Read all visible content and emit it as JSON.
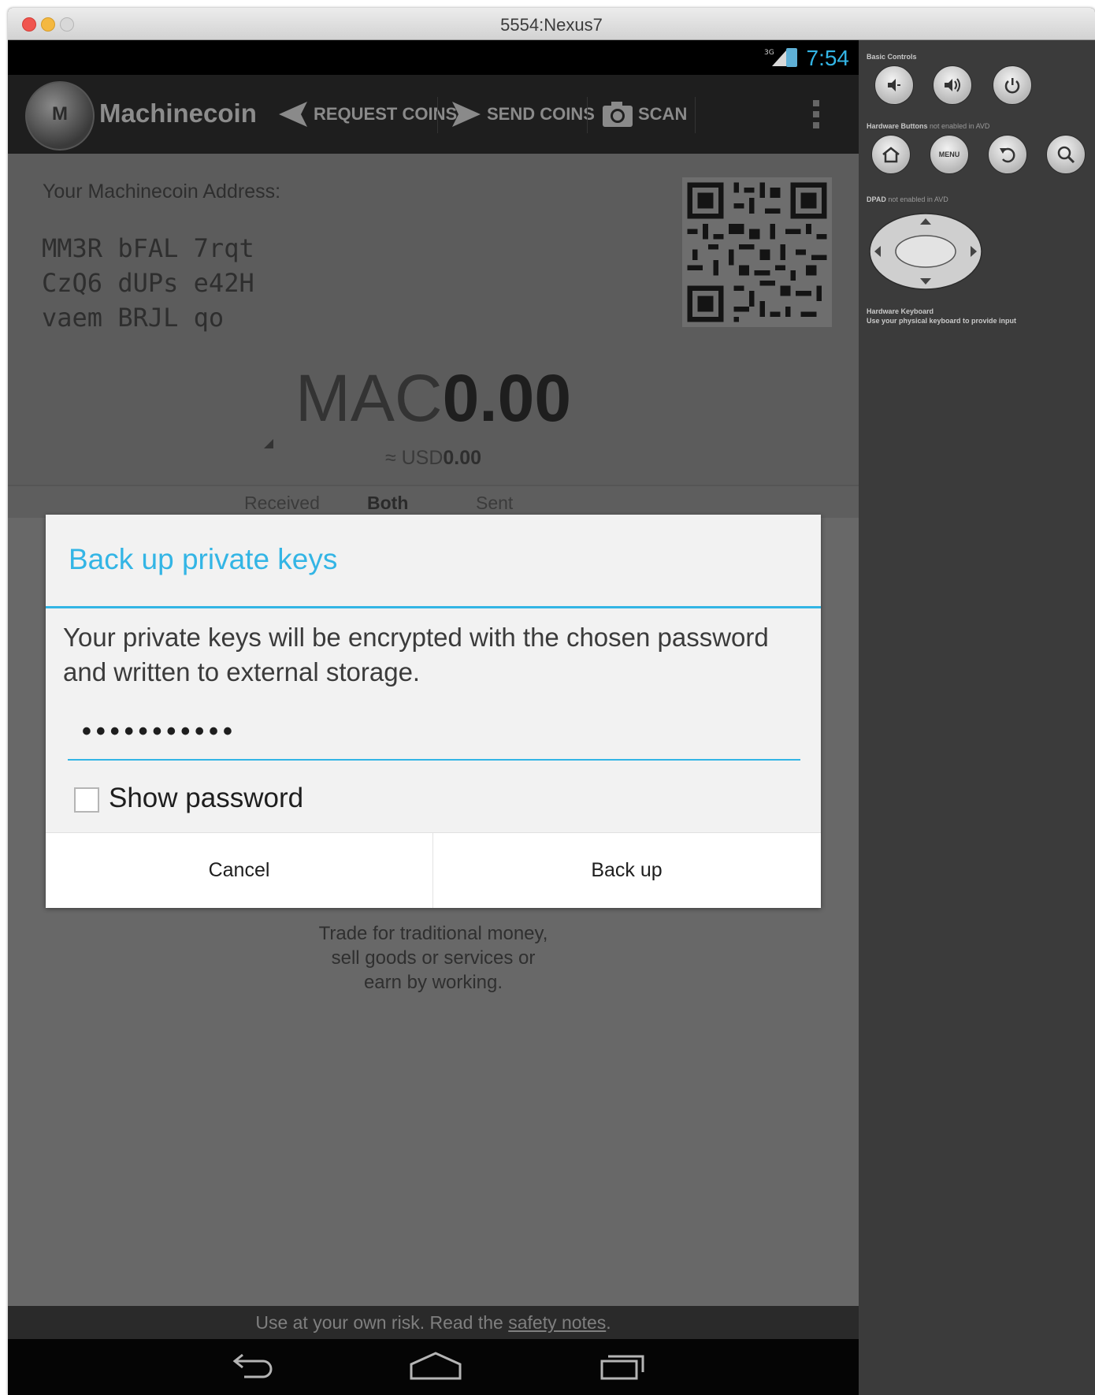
{
  "window": {
    "title": "5554:Nexus7"
  },
  "status_bar": {
    "time": "7:54",
    "network": "3G"
  },
  "action_bar": {
    "app_name": "Machinecoin",
    "request_label": "REQUEST COINS",
    "send_label": "SEND COINS",
    "scan_label": "SCAN"
  },
  "wallet": {
    "address_label": "Your Machinecoin Address:",
    "address_lines": [
      "MM3R bFAL 7rqt",
      "CzQ6 dUPs e42H",
      "vaem BRJL qo"
    ],
    "currency": "MAC",
    "balance": "0.00",
    "fiat_prefix": "≈ USD",
    "fiat_value": "0.00"
  },
  "tabs": [
    {
      "label": "Received"
    },
    {
      "label": "Both"
    },
    {
      "label": "Sent"
    }
  ],
  "empty_state": {
    "lines": [
      "Trade for traditional money,",
      "sell goods or services or",
      "earn by working."
    ]
  },
  "footer": {
    "risk_text": "Use at your own risk. Read the",
    "link_text": "safety notes",
    "suffix": "."
  },
  "dialog": {
    "title": "Back up private keys",
    "message": "Your private keys will be encrypted with the chosen password and written to external storage.",
    "password_mask": "•••••••••••",
    "show_password_label": "Show password",
    "show_password_checked": false,
    "cancel_label": "Cancel",
    "confirm_label": "Back up"
  },
  "emulator_panel": {
    "basic_controls_label": "Basic Controls",
    "hardware_buttons_label": "Hardware Buttons",
    "hardware_buttons_note": "not enabled in AVD",
    "dpad_label": "DPAD",
    "dpad_note": "not enabled in AVD",
    "keyboard_label": "Hardware Keyboard",
    "keyboard_note": "Use your physical keyboard to provide input",
    "menu_button_label": "MENU"
  },
  "colors": {
    "accent": "#33b5e5",
    "action_bar": "#1e1e1e",
    "dialog_bg": "#f2f2f2"
  }
}
